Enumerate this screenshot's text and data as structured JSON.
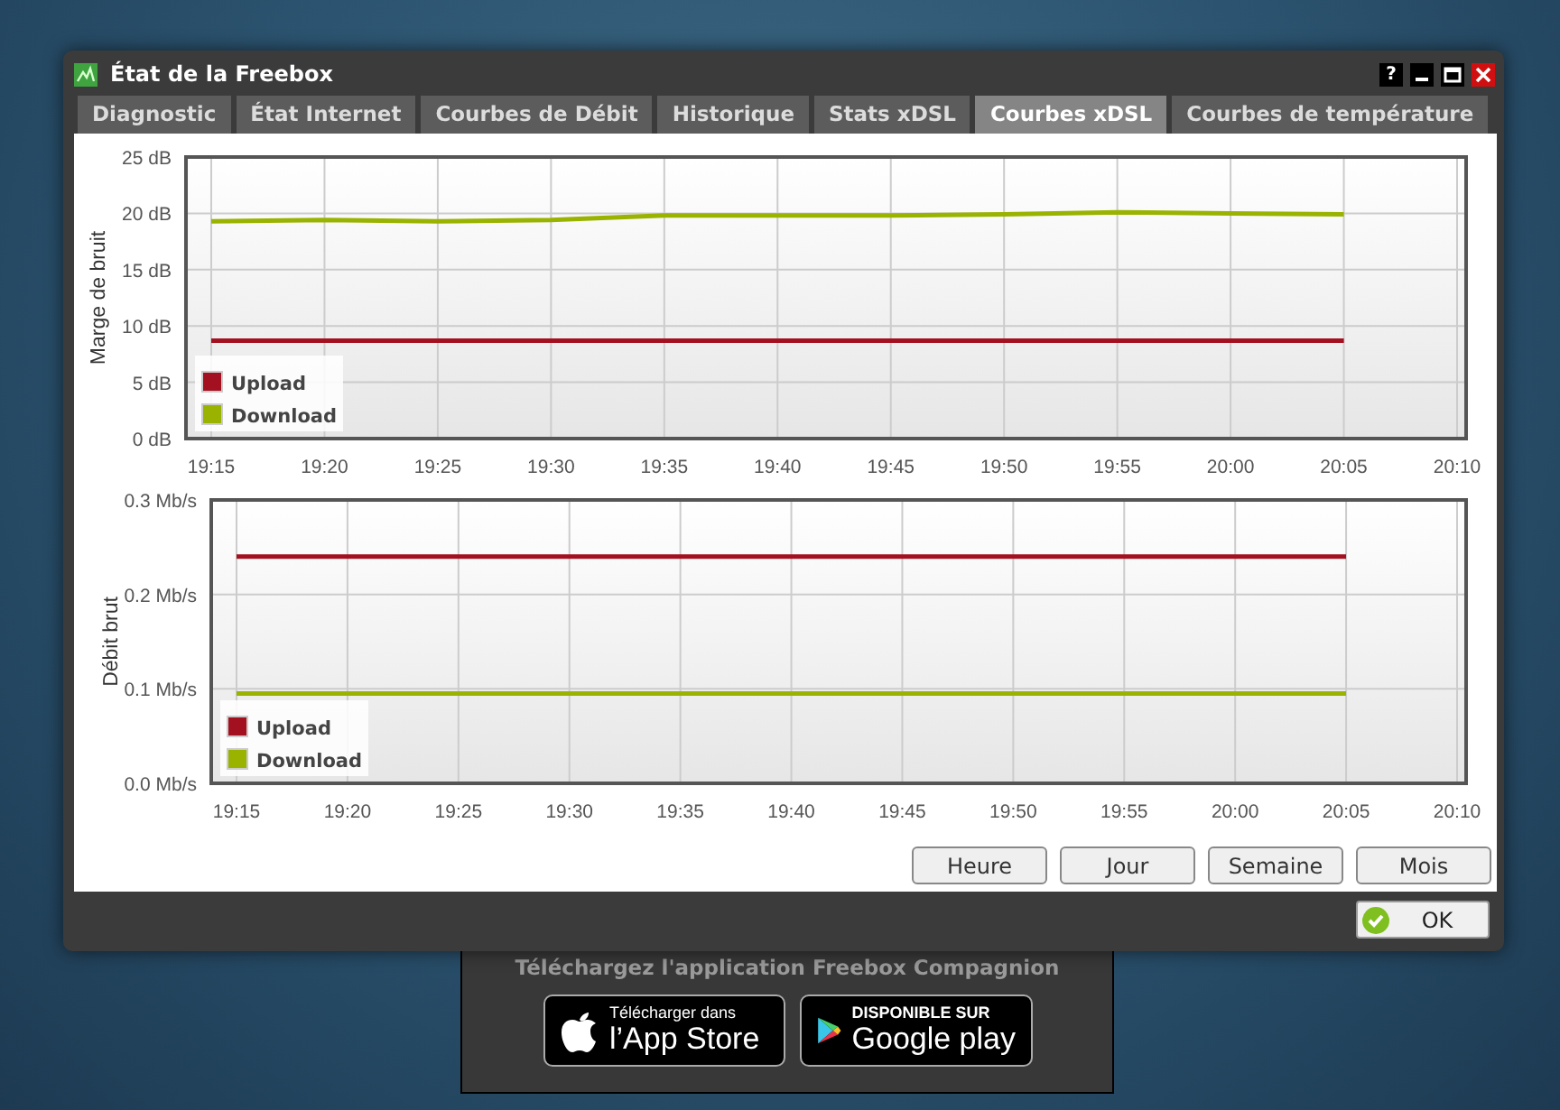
{
  "window": {
    "title": "État de la Freebox",
    "help_button": "?"
  },
  "tabs": [
    {
      "label": "Diagnostic",
      "selected": false
    },
    {
      "label": "État Internet",
      "selected": false
    },
    {
      "label": "Courbes de Débit",
      "selected": false
    },
    {
      "label": "Historique",
      "selected": false
    },
    {
      "label": "Stats xDSL",
      "selected": false
    },
    {
      "label": "Courbes xDSL",
      "selected": true
    },
    {
      "label": "Courbes de température",
      "selected": false
    }
  ],
  "charts": [
    {
      "chart_data": {
        "type": "line",
        "grid": true,
        "legend": true,
        "ylabel": "Marge de bruit",
        "categories": [
          "19:15",
          "19:20",
          "19:25",
          "19:30",
          "19:35",
          "19:40",
          "19:45",
          "19:50",
          "19:55",
          "20:00",
          "20:05",
          "20:10"
        ],
        "ylim": [
          0,
          25
        ],
        "yticks": [
          {
            "value": 0,
            "label": "0 dB"
          },
          {
            "value": 5,
            "label": "5 dB"
          },
          {
            "value": 10,
            "label": "10 dB"
          },
          {
            "value": 15,
            "label": "15 dB"
          },
          {
            "value": 20,
            "label": "20 dB"
          },
          {
            "value": 25,
            "label": "25 dB"
          }
        ],
        "series": [
          {
            "name": "Upload",
            "color": "#a3101f",
            "values": [
              8.7,
              8.7,
              8.7,
              8.7,
              8.7,
              8.7,
              8.7,
              8.7,
              8.7,
              8.7,
              8.7,
              null
            ]
          },
          {
            "name": "Download",
            "color": "#99b300",
            "values": [
              19.3,
              19.4,
              19.3,
              19.4,
              19.8,
              19.8,
              19.8,
              19.9,
              20.1,
              20.0,
              19.9,
              null
            ]
          }
        ]
      }
    },
    {
      "chart_data": {
        "type": "line",
        "grid": true,
        "legend": true,
        "ylabel": "Débit brut",
        "categories": [
          "19:15",
          "19:20",
          "19:25",
          "19:30",
          "19:35",
          "19:40",
          "19:45",
          "19:50",
          "19:55",
          "20:00",
          "20:05",
          "20:10"
        ],
        "ylim": [
          0,
          0.3
        ],
        "yticks": [
          {
            "value": 0,
            "label": "0.0 Mb/s"
          },
          {
            "value": 0.1,
            "label": "0.1 Mb/s"
          },
          {
            "value": 0.2,
            "label": "0.2 Mb/s"
          },
          {
            "value": 0.3,
            "label": "0.3 Mb/s"
          }
        ],
        "series": [
          {
            "name": "Upload",
            "color": "#a3101f",
            "values": [
              0.24,
              0.24,
              0.24,
              0.24,
              0.24,
              0.24,
              0.24,
              0.24,
              0.24,
              0.24,
              0.24,
              null
            ]
          },
          {
            "name": "Download",
            "color": "#99b300",
            "values": [
              0.095,
              0.095,
              0.095,
              0.095,
              0.095,
              0.095,
              0.095,
              0.095,
              0.095,
              0.095,
              0.095,
              null
            ]
          }
        ]
      }
    }
  ],
  "range_buttons": [
    "Heure",
    "Jour",
    "Semaine",
    "Mois"
  ],
  "ok_button": "OK",
  "promo": {
    "text": "Téléchargez l'application Freebox Compagnion",
    "app_store": {
      "line1": "Télécharger dans",
      "line2": "l’App Store"
    },
    "google_play": {
      "line1": "DISPONIBLE SUR",
      "line2": "Google play"
    }
  }
}
